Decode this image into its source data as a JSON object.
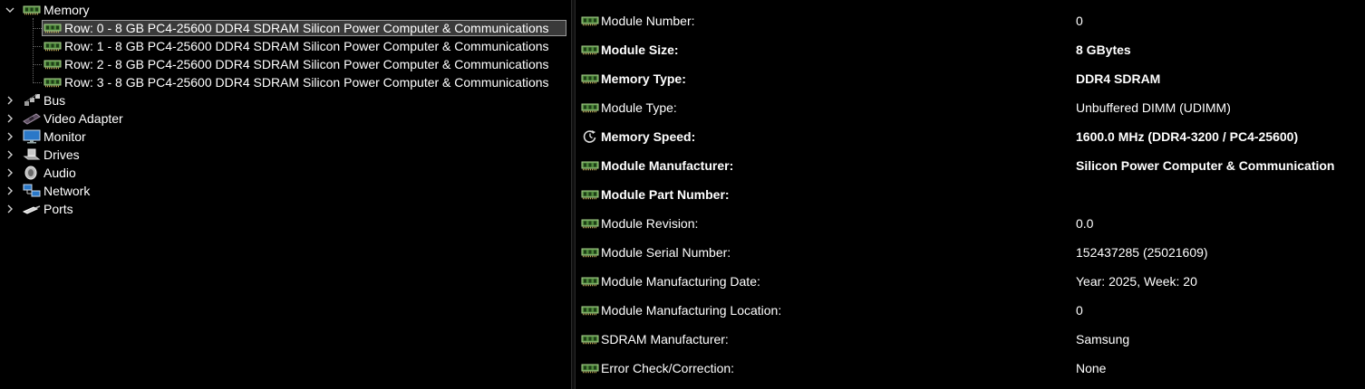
{
  "tree": {
    "root": {
      "label": "Memory",
      "icon": "memory-module-icon",
      "expanded": true,
      "children": [
        {
          "label": "Row: 0 - 8 GB PC4-25600 DDR4 SDRAM Silicon Power Computer & Communications",
          "icon": "memory-module-icon",
          "selected": true
        },
        {
          "label": "Row: 1 - 8 GB PC4-25600 DDR4 SDRAM Silicon Power Computer & Communications",
          "icon": "memory-module-icon"
        },
        {
          "label": "Row: 2 - 8 GB PC4-25600 DDR4 SDRAM Silicon Power Computer & Communications",
          "icon": "memory-module-icon"
        },
        {
          "label": "Row: 3 - 8 GB PC4-25600 DDR4 SDRAM Silicon Power Computer & Communications",
          "icon": "memory-module-icon"
        }
      ]
    },
    "categories": [
      {
        "label": "Bus",
        "icon": "bus-icon"
      },
      {
        "label": "Video Adapter",
        "icon": "video-adapter-icon"
      },
      {
        "label": "Monitor",
        "icon": "monitor-icon"
      },
      {
        "label": "Drives",
        "icon": "drive-icon"
      },
      {
        "label": "Audio",
        "icon": "speaker-icon"
      },
      {
        "label": "Network",
        "icon": "network-icon"
      },
      {
        "label": "Ports",
        "icon": "port-icon"
      }
    ]
  },
  "properties": [
    {
      "name": "Module Number:",
      "value": "0",
      "bold": false,
      "icon": "memory-module-icon"
    },
    {
      "name": "Module Size:",
      "value": "8 GBytes",
      "bold": true,
      "icon": "memory-module-icon"
    },
    {
      "name": "Memory Type:",
      "value": "DDR4 SDRAM",
      "bold": true,
      "icon": "memory-module-icon"
    },
    {
      "name": "Module Type:",
      "value": "Unbuffered DIMM (UDIMM)",
      "bold": false,
      "icon": "memory-module-icon"
    },
    {
      "name": "Memory Speed:",
      "value": "1600.0 MHz (DDR4-3200 / PC4-25600)",
      "bold": true,
      "icon": "speed-clock-icon"
    },
    {
      "name": "Module Manufacturer:",
      "value": "Silicon Power Computer & Communication",
      "bold": true,
      "icon": "memory-module-icon"
    },
    {
      "name": "Module Part Number:",
      "value": "",
      "bold": true,
      "icon": "memory-module-icon"
    },
    {
      "name": "Module Revision:",
      "value": "0.0",
      "bold": false,
      "icon": "memory-module-icon"
    },
    {
      "name": "Module Serial Number:",
      "value": "152437285 (25021609)",
      "bold": false,
      "icon": "memory-module-icon"
    },
    {
      "name": "Module Manufacturing Date:",
      "value": "Year: 2025, Week: 20",
      "bold": false,
      "icon": "memory-module-icon"
    },
    {
      "name": "Module Manufacturing Location:",
      "value": "0",
      "bold": false,
      "icon": "memory-module-icon"
    },
    {
      "name": "SDRAM Manufacturer:",
      "value": "Samsung",
      "bold": false,
      "icon": "memory-module-icon"
    },
    {
      "name": "Error Check/Correction:",
      "value": "None",
      "bold": false,
      "icon": "memory-module-icon"
    }
  ],
  "colors": {
    "background": "#000000",
    "text": "#ffffff",
    "selection": "#3a3a3a",
    "selection_border": "#9a9a9a",
    "module_green": "#4f8a3c"
  }
}
